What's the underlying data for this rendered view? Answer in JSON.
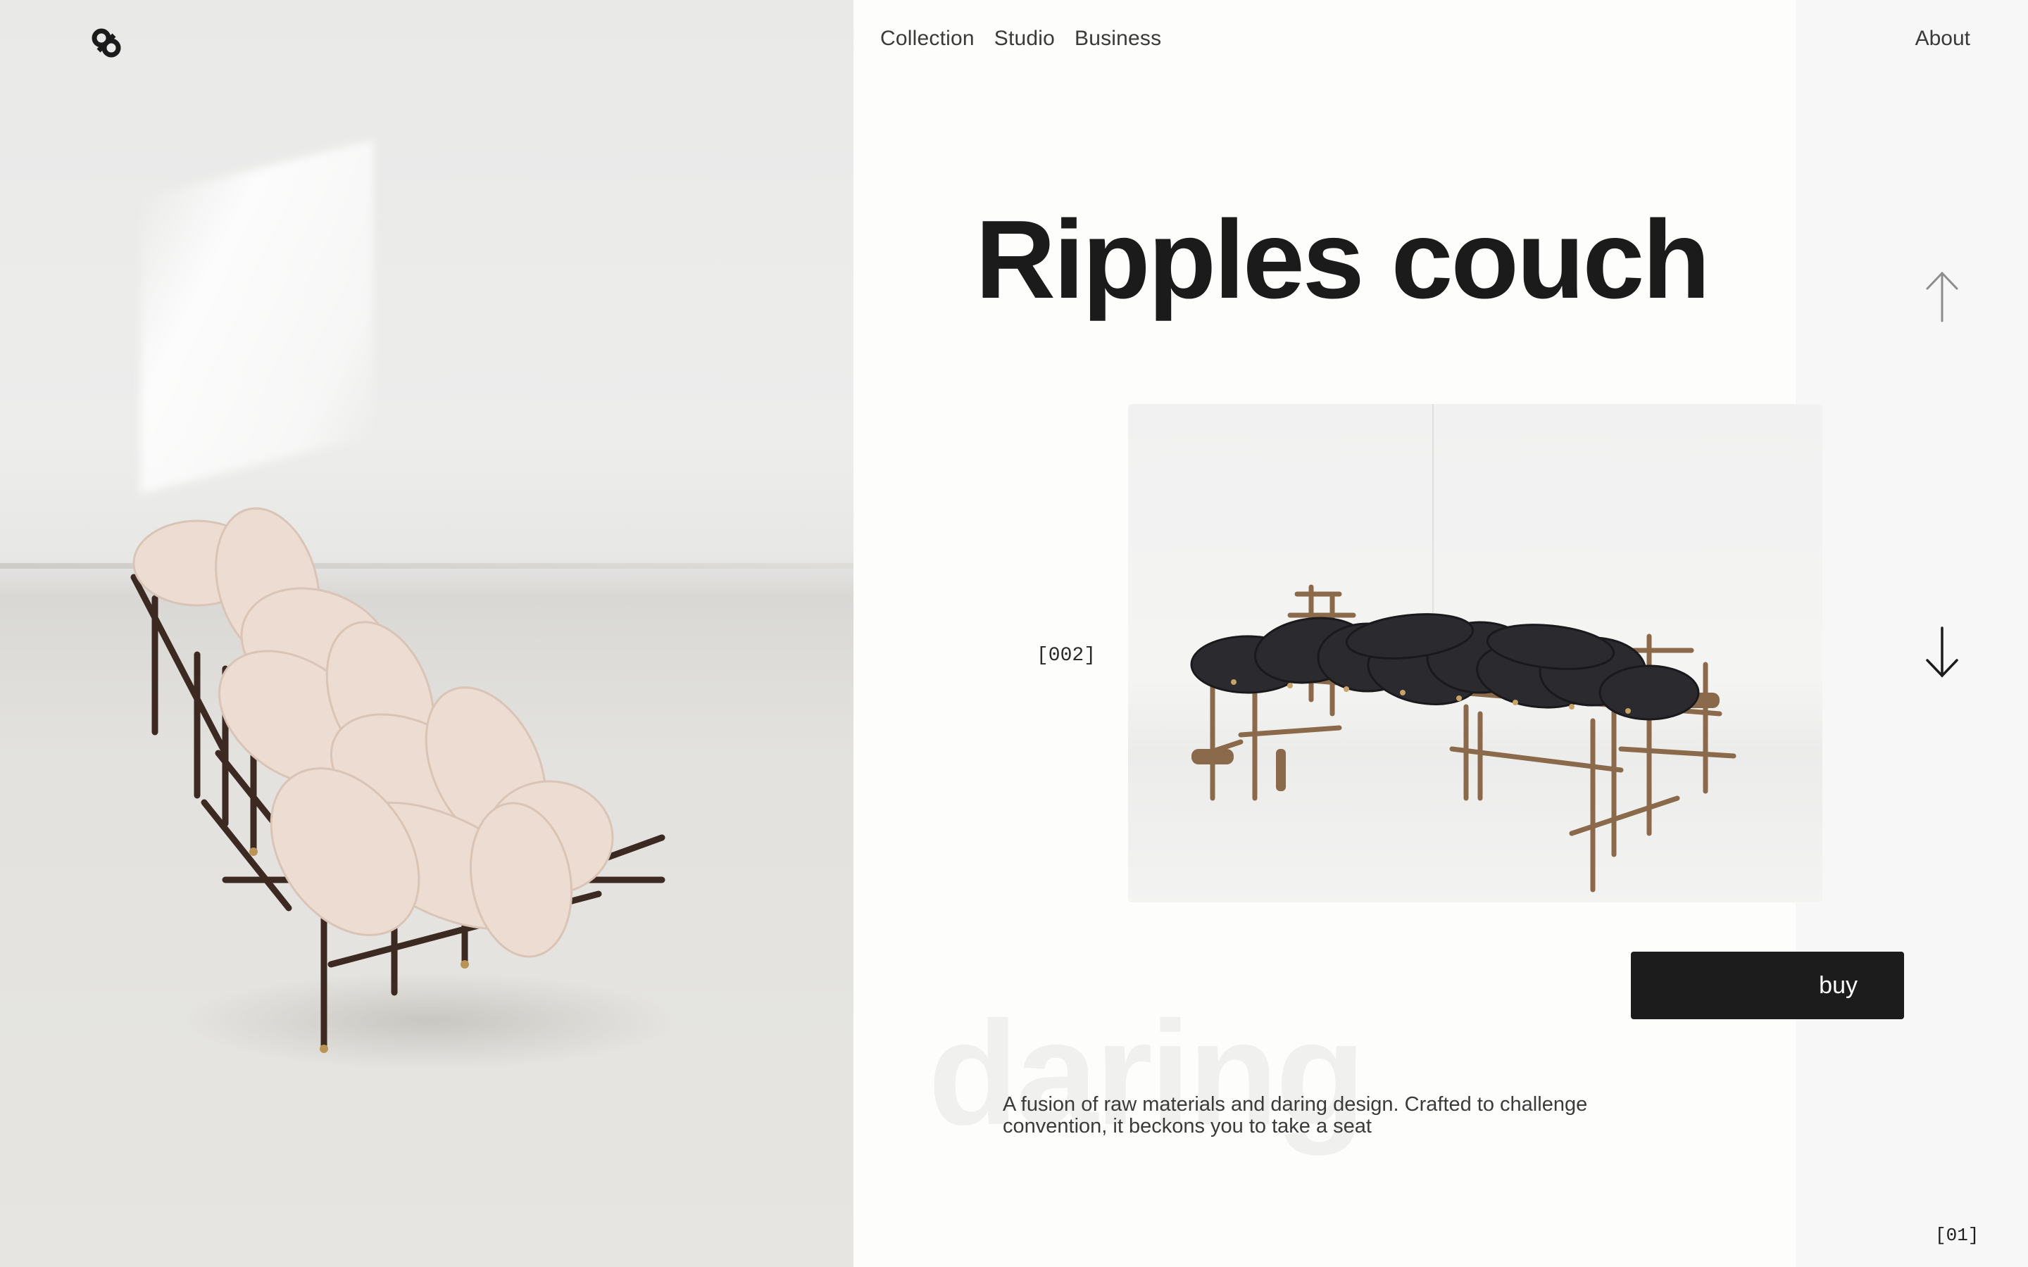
{
  "brand": {
    "logo_icon": "interlocking-knot-logo-icon"
  },
  "nav": {
    "items": [
      {
        "label": "Collection"
      },
      {
        "label": "Studio"
      },
      {
        "label": "Business"
      }
    ],
    "about_label": "About"
  },
  "product": {
    "title": "Ripples couch",
    "index": "[002]",
    "buy_label": "buy",
    "watermark": "daring",
    "description": "A fusion of raw materials and daring design. Crafted to challenge convention, it beckons you to take a seat"
  },
  "pager": {
    "counter": "[01]",
    "up_icon": "arrow-up-icon",
    "down_icon": "arrow-down-icon"
  },
  "colors": {
    "primary_text": "#1b1b1b",
    "button_bg": "#1c1c1c",
    "panel_bg": "#fdfdfc",
    "side_strip": "#f7f7f7"
  }
}
